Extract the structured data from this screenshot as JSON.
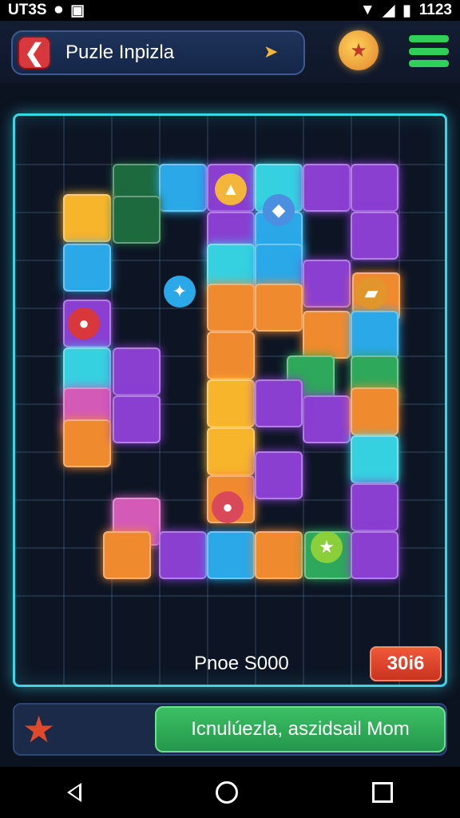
{
  "status_bar": {
    "left_text": "UT3S",
    "time": "1123",
    "icons": [
      "notification-icon",
      "sim-icon",
      "wifi-icon",
      "signal-icon",
      "battery-icon"
    ]
  },
  "header": {
    "title": "Puzle Inpizla",
    "back_icon": "back-arrow-icon",
    "arrow_icon": "small-arrow-icon",
    "badge_icon": "trophy-badge-icon",
    "menu_icon": "hamburger-menu-icon"
  },
  "board": {
    "price_label": "Pnoe S000",
    "score": "30i6"
  },
  "bottom_bar": {
    "star_icon": "star-icon",
    "action_label": "Icnulúezla, aszidsail Mom"
  },
  "colors": {
    "board_border": "#38d6e6",
    "action_green": "#3cc065",
    "score_red": "#e0482c",
    "back_red": "#d8373b"
  }
}
